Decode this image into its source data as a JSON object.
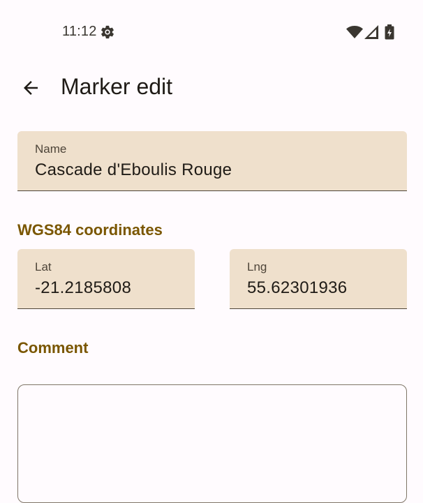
{
  "status_bar": {
    "time": "11:12",
    "icons": [
      "gear-icon",
      "wifi-icon",
      "cellular-signal-icon",
      "battery-charging-icon"
    ]
  },
  "app_bar": {
    "title": "Marker edit",
    "back_icon": "arrow-back-icon"
  },
  "form": {
    "name": {
      "label": "Name",
      "value": "Cascade d'Eboulis Rouge"
    },
    "coordinates_header": "WGS84 coordinates",
    "lat": {
      "label": "Lat",
      "value": "-21.2185808"
    },
    "lng": {
      "label": "Lng",
      "value": "55.62301936"
    },
    "comment_header": "Comment",
    "comment": {
      "value": ""
    }
  },
  "colors": {
    "background": "#FFFBFE",
    "field_fill": "#EFE0CC",
    "accent": "#7A5600",
    "text": "#1F1B16"
  }
}
